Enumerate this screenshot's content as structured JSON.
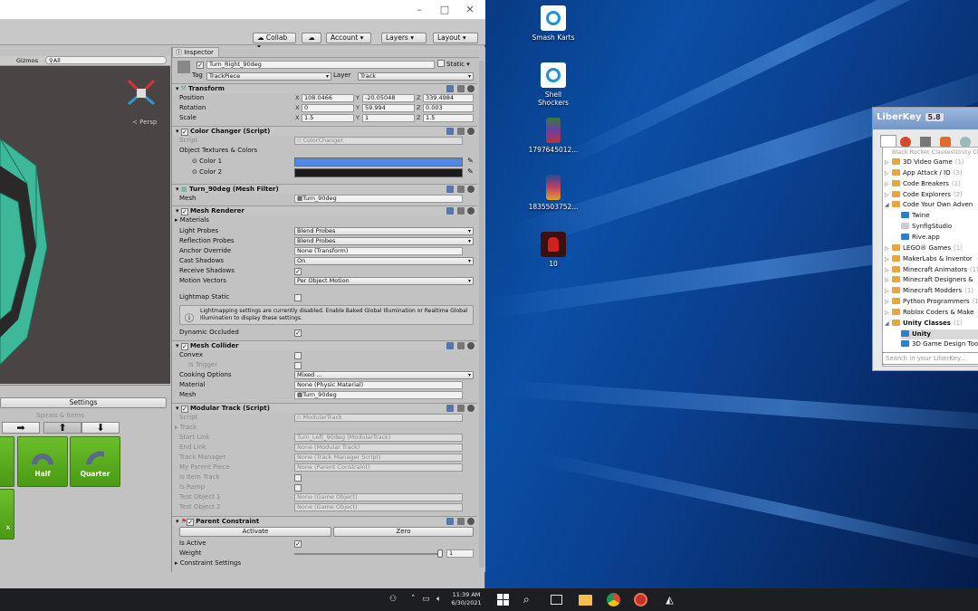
{
  "desktop": {
    "icons": [
      {
        "label": "Smash Karts",
        "icon": "ie-icon"
      },
      {
        "label": "Shell\nShockers",
        "icon": "ie-icon"
      },
      {
        "label": "1797645012...",
        "icon": "image-icon"
      },
      {
        "label": "1835503752...",
        "icon": "image-icon"
      },
      {
        "label": "10",
        "icon": "among-us-icon"
      }
    ]
  },
  "unity": {
    "toolbar": {
      "collab": "Collab",
      "account": "Account",
      "layers": "Layers",
      "layout": "Layout"
    },
    "scene": {
      "gizmos": "Gizmos",
      "search": "All",
      "persp": "Persp"
    },
    "tools": {
      "settings": "Settings",
      "section": "Spirals & Items",
      "tiles": [
        {
          "label": ""
        },
        {
          "label": "Half"
        },
        {
          "label": "Quarter"
        },
        {
          "label": "×"
        }
      ]
    },
    "inspector": {
      "tab": "Inspector",
      "object_name": "Turn_Right_90deg",
      "static_label": "Static",
      "tag_label": "Tag",
      "tag_value": "TrackPiece",
      "layer_label": "Layer",
      "layer_value": "Track",
      "transform": {
        "title": "Transform",
        "position_label": "Position",
        "position": [
          "108.0466",
          "-20.05048",
          "339.4984"
        ],
        "rotation_label": "Rotation",
        "rotation": [
          "0",
          "59.994",
          "0.003"
        ],
        "scale_label": "Scale",
        "scale": [
          "1.5",
          "1",
          "1.5"
        ]
      },
      "color_changer": {
        "title": "Color Changer (Script)",
        "script_label": "Script",
        "script_value": "ColorChanger",
        "textures_label": "Object Textures & Colors",
        "color1": "Color 1",
        "color2": "Color 2",
        "color1_hex": "#4d8ae6",
        "color2_hex": "#1b1b1b"
      },
      "mesh_filter": {
        "title": "Turn_90deg (Mesh Filter)",
        "mesh_label": "Mesh",
        "mesh_value": "Turn_90deg"
      },
      "mesh_renderer": {
        "title": "Mesh Renderer",
        "materials": "Materials",
        "light_probes_label": "Light Probes",
        "light_probes": "Blend Probes",
        "reflection_label": "Reflection Probes",
        "reflection": "Blend Probes",
        "anchor_label": "Anchor Override",
        "anchor": "None (Transform)",
        "cast_label": "Cast Shadows",
        "cast": "On",
        "receive_label": "Receive Shadows",
        "motion_label": "Motion Vectors",
        "motion": "Per Object Motion",
        "lightmap_label": "Lightmap Static",
        "info": "Lightmapping settings are currently disabled. Enable Baked Global Illumination or Realtime Global Illumination to display these settings.",
        "dynamic_label": "Dynamic Occluded"
      },
      "mesh_collider": {
        "title": "Mesh Collider",
        "convex": "Convex",
        "trigger": "Is Trigger",
        "cooking_label": "Cooking Options",
        "cooking": "Mixed ...",
        "material_label": "Material",
        "material": "None (Physic Material)",
        "mesh_label": "Mesh",
        "mesh": "Turn_90deg"
      },
      "modular_track": {
        "title": "Modular Track (Script)",
        "script_label": "Script",
        "script_value": "ModularTrack",
        "track": "Track",
        "start_label": "Start Link",
        "start": "Turn_Left_90deg (ModularTrack)",
        "end_label": "End Link",
        "end": "None (Modular Track)",
        "manager_label": "Track Manager",
        "manager": "None (Track Manager Script)",
        "parent_label": "My Parent Piece",
        "parent": "None (Parent Constraint)",
        "item_label": "Is Item Track",
        "ramp_label": "Is Ramp",
        "t1_label": "Test Object 1",
        "t1": "None (Game Object)",
        "t2_label": "Test Object 2",
        "t2": "None (Game Object)"
      },
      "parent_constraint": {
        "title": "Parent Constraint",
        "activate": "Activate",
        "zero": "Zero",
        "active_label": "Is Active",
        "weight_label": "Weight",
        "weight": "1",
        "weight_fraction": 1.0,
        "settings": "Constraint Settings"
      }
    }
  },
  "liberkey": {
    "title": "LiberKey",
    "version": "5.8",
    "breadcrumb": "Black Rocket Classes\\Unity Cla",
    "items": [
      {
        "label": "3D Video Game",
        "count": "(1)"
      },
      {
        "label": "App Attack / IO",
        "count": "(3)"
      },
      {
        "label": "Code Breakers",
        "count": "(1)"
      },
      {
        "label": "Code Explorers",
        "count": "(2)"
      },
      {
        "label": "Code Your Own Adven",
        "count": ""
      },
      {
        "label": "Twine",
        "count": ""
      },
      {
        "label": "SynfigStudio",
        "count": ""
      },
      {
        "label": "Rive.app",
        "count": ""
      },
      {
        "label": "LEGO® Games",
        "count": "(1)"
      },
      {
        "label": "MakerLabs & Inventor",
        "count": ""
      },
      {
        "label": "Minecraft Animators",
        "count": "(1)"
      },
      {
        "label": "Minecraft Designers &",
        "count": ""
      },
      {
        "label": "Minecraft Modders",
        "count": "(1)"
      },
      {
        "label": "Python Programmers",
        "count": "(1"
      },
      {
        "label": "Roblox Coders & Make",
        "count": ""
      },
      {
        "label": "Unity Classes",
        "count": "(1)"
      },
      {
        "label": "Unity",
        "count": ""
      },
      {
        "label": "3D Game Design Too",
        "count": ""
      }
    ],
    "search_placeholder": "Search in your LiberKey..."
  },
  "taskbar": {
    "time": "11:39 AM",
    "date": "6/30/2021"
  }
}
